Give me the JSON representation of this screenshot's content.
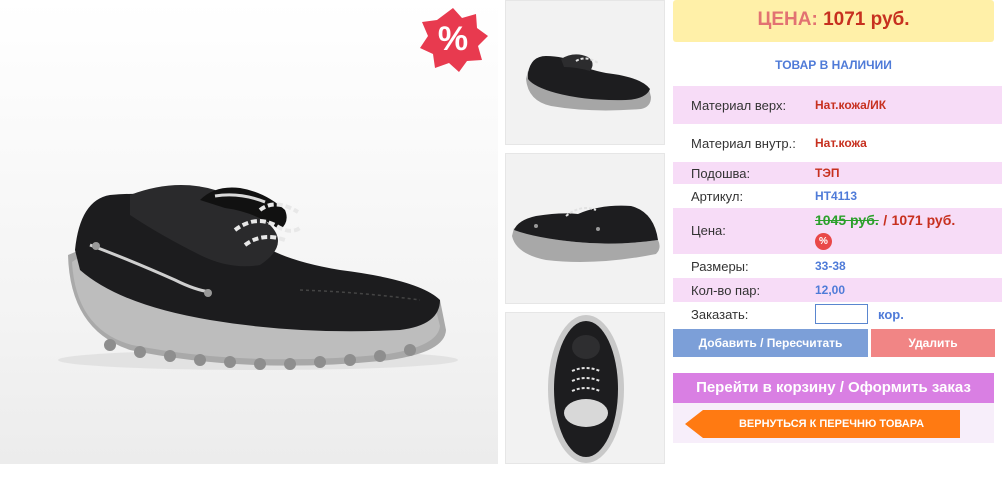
{
  "product": {
    "sale_badge": "%",
    "main_image_alt": "",
    "thumbnails": [
      {
        "label": ""
      },
      {
        "label": ""
      },
      {
        "label": ""
      }
    ]
  },
  "panel": {
    "price_label": "ЦЕНА:",
    "price_value": "1071 руб.",
    "stock_status": "ТОВАР В НАЛИЧИИ",
    "specs": {
      "upper_label": "Материал верх:",
      "upper_value": "Нат.кожа/ИК",
      "lining_label": "Материал внутр.:",
      "lining_value": "Нат.кожа",
      "sole_label": "Подошва:",
      "sole_value": "ТЭП",
      "article_label": "Артикул:",
      "article_value": "НТ4113",
      "price_label": "Цена:",
      "old_price": "1045 руб.",
      "price_separator": "/",
      "new_price": "1071 руб.",
      "discount_badge": "%",
      "sizes_label": "Размеры:",
      "sizes_value": "33-38",
      "pairs_label": "Кол-во пар:",
      "pairs_value": "12,00",
      "order_label": "Заказать:",
      "order_qty": "",
      "order_unit": "кор."
    },
    "buttons": {
      "add": "Добавить / Пересчитать",
      "delete": "Удалить",
      "cart": "Перейти в корзину / Оформить заказ",
      "back": "ВЕРНУТЬСЯ К ПЕРЕЧНЮ ТОВАРА"
    }
  },
  "colors": {
    "price_bg": "#fff0a8",
    "spec_pink": "#f7dcf7",
    "blue_text": "#4f7bd8",
    "red_text": "#c7301f",
    "cart_button": "#d97fe3",
    "back_button": "#ff7a12"
  }
}
